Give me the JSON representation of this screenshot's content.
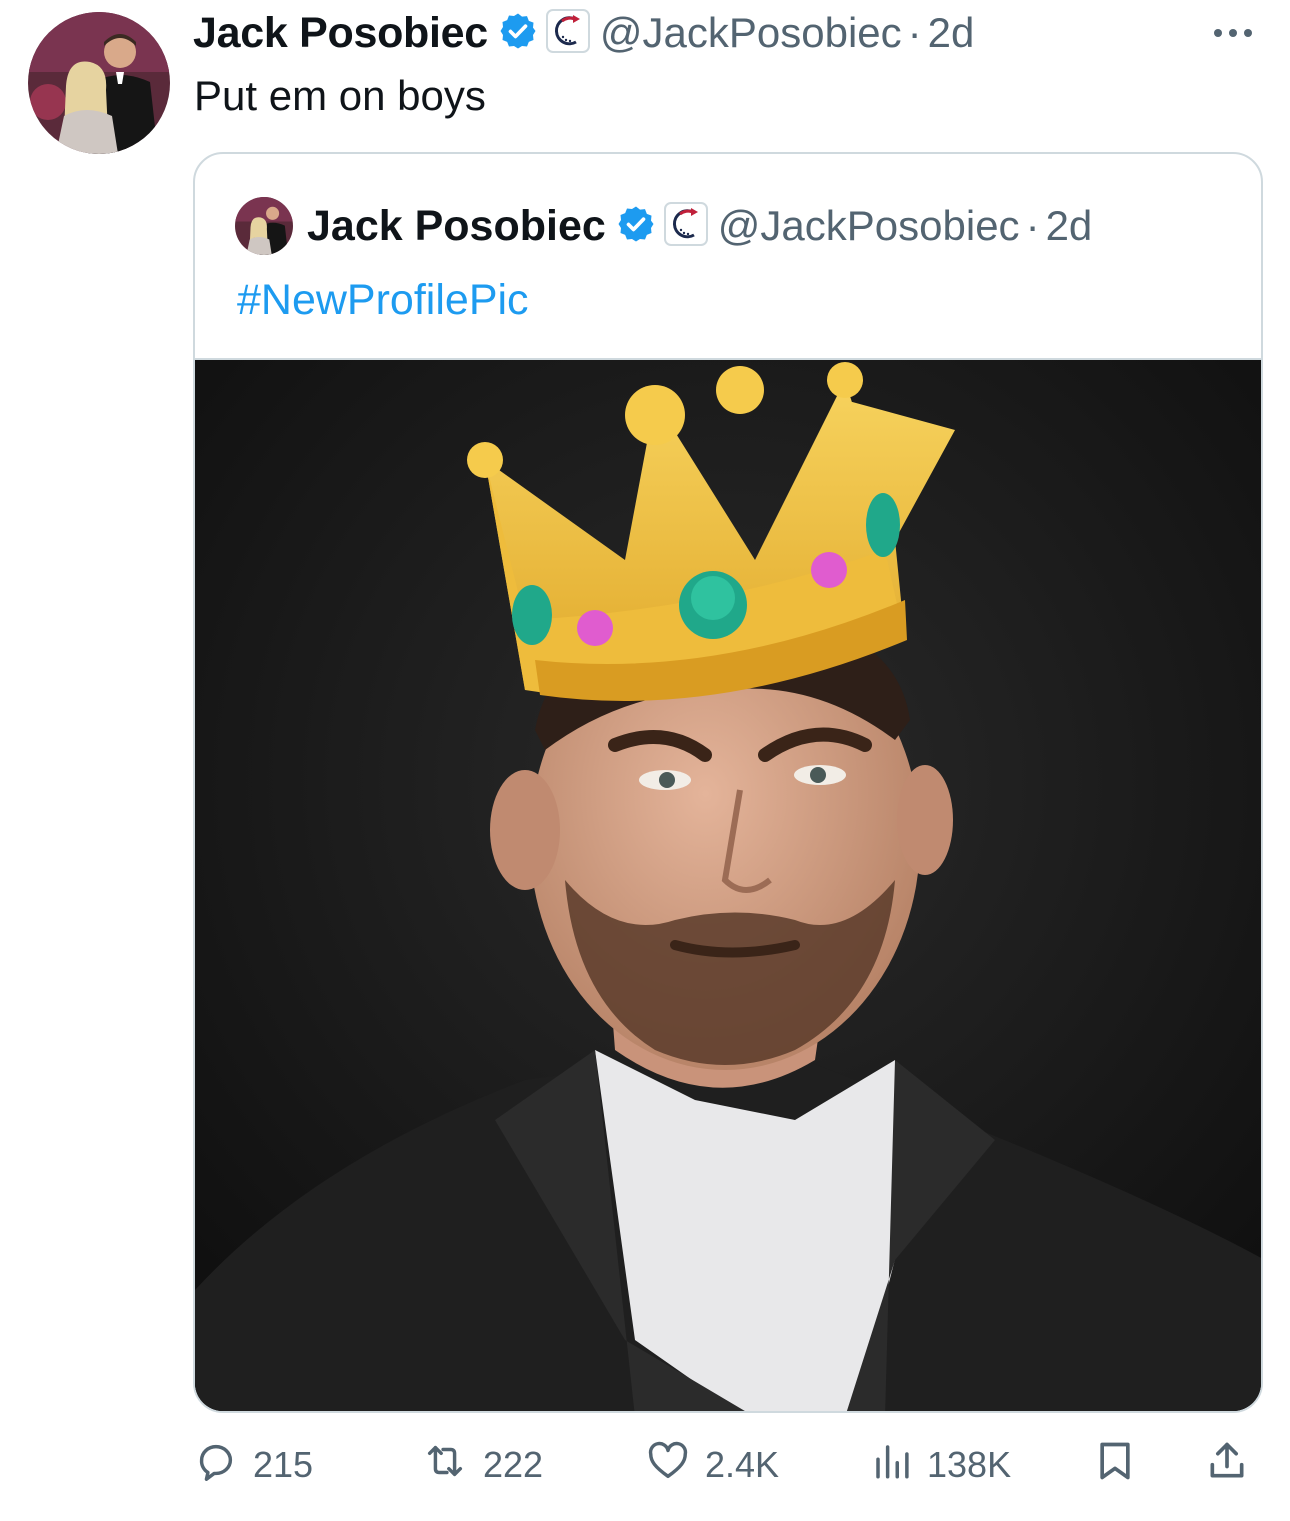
{
  "tweet": {
    "author_name": "Jack Posobiec",
    "handle": "@JackPosobiec",
    "separator": "·",
    "time": "2d",
    "text": "Put em on boys"
  },
  "quoted_tweet": {
    "author_name": "Jack Posobiec",
    "handle": "@JackPosobiec",
    "separator": "·",
    "time": "2d",
    "text": "#NewProfilePic"
  },
  "actions": {
    "replies": "215",
    "retweets": "222",
    "likes": "2.4K",
    "views": "138K"
  },
  "colors": {
    "verified_badge": "#1d9bf0",
    "hashtag": "#1d9bf0",
    "muted_text": "#536471",
    "border": "#cfd9de",
    "crown_gold": "#f4c44a",
    "gem_teal": "#20a88a",
    "gem_pink": "#e05ccf"
  },
  "icons": {
    "verified": "verified-check-icon",
    "affiliation": "affiliate-badge-icon",
    "more": "more-dots-icon",
    "reply": "reply-bubble-icon",
    "retweet": "retweet-icon",
    "like": "heart-icon",
    "views": "views-bar-chart-icon",
    "bookmark": "bookmark-icon",
    "share": "share-icon"
  }
}
